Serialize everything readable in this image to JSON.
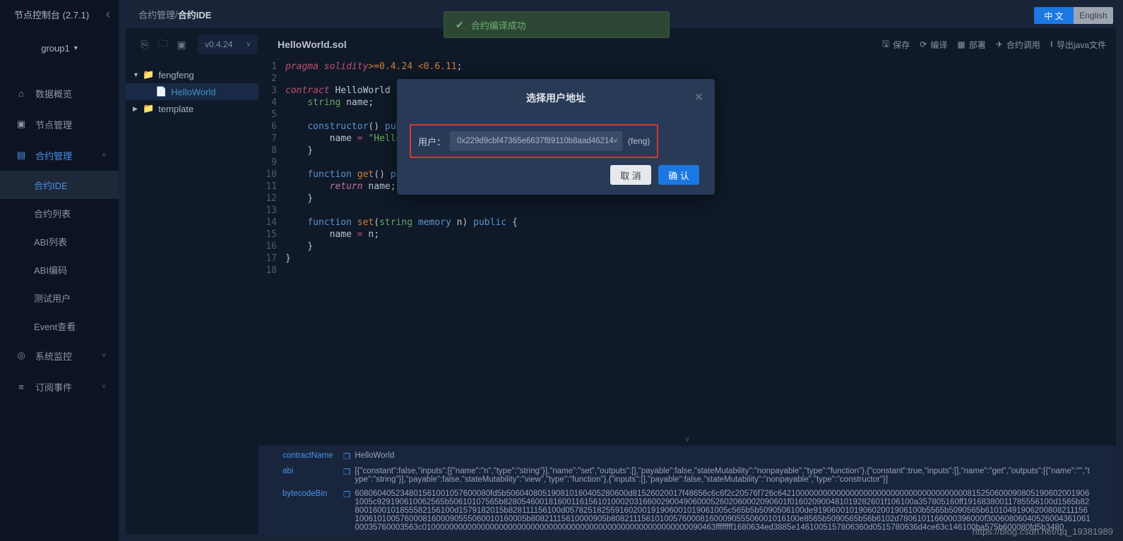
{
  "sidebar": {
    "title": "节点控制台 (2.7.1)",
    "group": "group1",
    "nav": {
      "data_overview": "数据概览",
      "node_mgmt": "节点管理",
      "contract_mgmt": "合约管理",
      "sys_monitor": "系统监控",
      "sub_events": "订阅事件",
      "subs": {
        "ide": "合约IDE",
        "list": "合约列表",
        "abi_list": "ABI列表",
        "abi_code": "ABI编码",
        "test_user": "测试用户",
        "event": "Event查看"
      }
    }
  },
  "breadcrumb": {
    "parent": "合约管理",
    "sep": " / ",
    "current": "合约IDE"
  },
  "lang": {
    "zh": "中 文",
    "en": "English"
  },
  "toolbar": {
    "version": "v0.4.24",
    "filename": "HelloWorld.sol",
    "actions": {
      "save": "保存",
      "compile": "编译",
      "deploy": "部署",
      "call": "合约调用",
      "export": "导出java文件"
    }
  },
  "tree": {
    "folders": {
      "fengfeng": "fengfeng",
      "template": "template"
    },
    "file": "HelloWorld"
  },
  "code": {
    "lines": [
      {
        "n": "1"
      },
      {
        "n": "2"
      },
      {
        "n": "3"
      },
      {
        "n": "4"
      },
      {
        "n": "5"
      },
      {
        "n": "6"
      },
      {
        "n": "7"
      },
      {
        "n": "8"
      },
      {
        "n": "9"
      },
      {
        "n": "10"
      },
      {
        "n": "11"
      },
      {
        "n": "12"
      },
      {
        "n": "13"
      },
      {
        "n": "14"
      },
      {
        "n": "15"
      },
      {
        "n": "16"
      },
      {
        "n": "17"
      },
      {
        "n": "18"
      }
    ],
    "pragma": "pragma solidity",
    "ver_a": ">=0.4.24",
    "ver_b": " <0.6.11",
    "contract": "contract",
    "cname": "HelloWorld",
    "string_t": "string",
    "name_var": "name",
    "constructor": "constructor",
    "public": "public",
    "hello_str": "\"Hello, Wo",
    "function": "function",
    "get": "get",
    "return": "return",
    "set": "set",
    "memory": "memory",
    "n_param": "n"
  },
  "alert": {
    "text": "合约编译成功"
  },
  "modal": {
    "title": "选择用户地址",
    "user_label": "用户：",
    "address": "0x229d9cbf47365e6637f89110b8aad46214",
    "suffix": "(feng)",
    "cancel": "取 消",
    "confirm": "确 认"
  },
  "bottom": {
    "contractName_label": "contractName",
    "contractName_val": "HelloWorld",
    "abi_label": "abi",
    "abi_val": "[{\"constant\":false,\"inputs\":[{\"name\":\"n\",\"type\":\"string\"}],\"name\":\"set\",\"outputs\":[],\"payable\":false,\"stateMutability\":\"nonpayable\",\"type\":\"function\"},{\"constant\":true,\"inputs\":[],\"name\":\"get\",\"outputs\":[{\"name\":\"\",\"type\":\"string\"}],\"payable\":false,\"stateMutability\":\"view\",\"type\":\"function\"},{\"inputs\":[],\"payable\":false,\"stateMutability\":\"nonpayable\",\"type\":\"constructor\"}]",
    "bytecode_label": "bytecodeBin",
    "bytecode_val": "608060405234801561001057600080fd5b506040805190810160405280600d81526020017f48656c6c6f2c20576f726c6421000000000000000000000000000000000000008152506000908051906020019061005c929190610062565b50610107565b828054600181600116156101000203166002900490600052602060002090601f016020900481019282601f106100a357805160ff19168380011785556100d1565b828001600101855582156100d1579182015b828111156100d057825182559160200191906001019061005c565b5b5090506100de919060010190602001906100b5565b5090565b6101049190620080821115610061010057600081600090555060010160005b80821115610000905b808211156101005760008160009055506001016100e8565b5090565b56b6102d7806101166000396000f3006080604052600436106100035760003563c01000000000000000000000000000000000000000000000000000000000090463ffffffff1680634ed3885e1461005157806360d0515780636d4ce63c146100ba575b600080fd5b3480"
  },
  "watermark": "https://blog.csdn.net/qq_19381989"
}
